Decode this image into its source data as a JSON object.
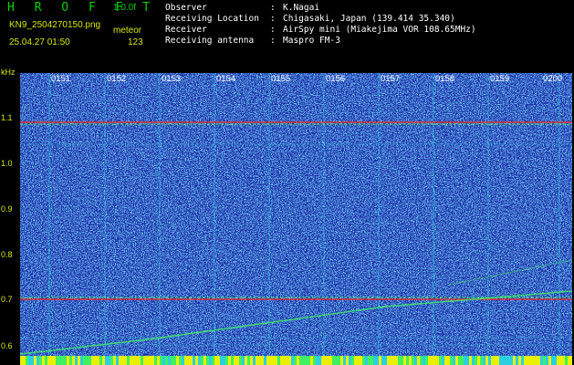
{
  "header": {
    "title": "H R O F F T",
    "version": "1.0.0f",
    "filename": "KN9_2504270150.png",
    "mode": "meteor",
    "timestamp": "25.04.27 01:50",
    "count": "123"
  },
  "info": [
    {
      "key": "Observer",
      "value": "K.Nagai"
    },
    {
      "key": "Receiving Location",
      "value": "Chigasaki, Japan (139.414 35.340)"
    },
    {
      "key": "Receiver",
      "value": "AirSpy mini (Miakejima VOR 108.65MHz)"
    },
    {
      "key": "Receiving antenna",
      "value": "Maspro FM-3"
    }
  ],
  "axis": {
    "unit": "kHz",
    "y_ticks": [
      "1.1",
      "1.0",
      "0.9",
      "0.8",
      "0.7",
      "0.6"
    ],
    "time_ticks": [
      "0151",
      "0152",
      "0153",
      "0154",
      "0155",
      "0156",
      "0157",
      "0158",
      "0159",
      "0200"
    ]
  },
  "colors": {
    "background": "#1e2fa8",
    "noise_light": "#3a7cf0",
    "noise_cyan": "#2ad0e0",
    "carrier_red": "#ff2020",
    "carrier_green": "#40f060",
    "label_yellow": "#d8e800"
  }
}
